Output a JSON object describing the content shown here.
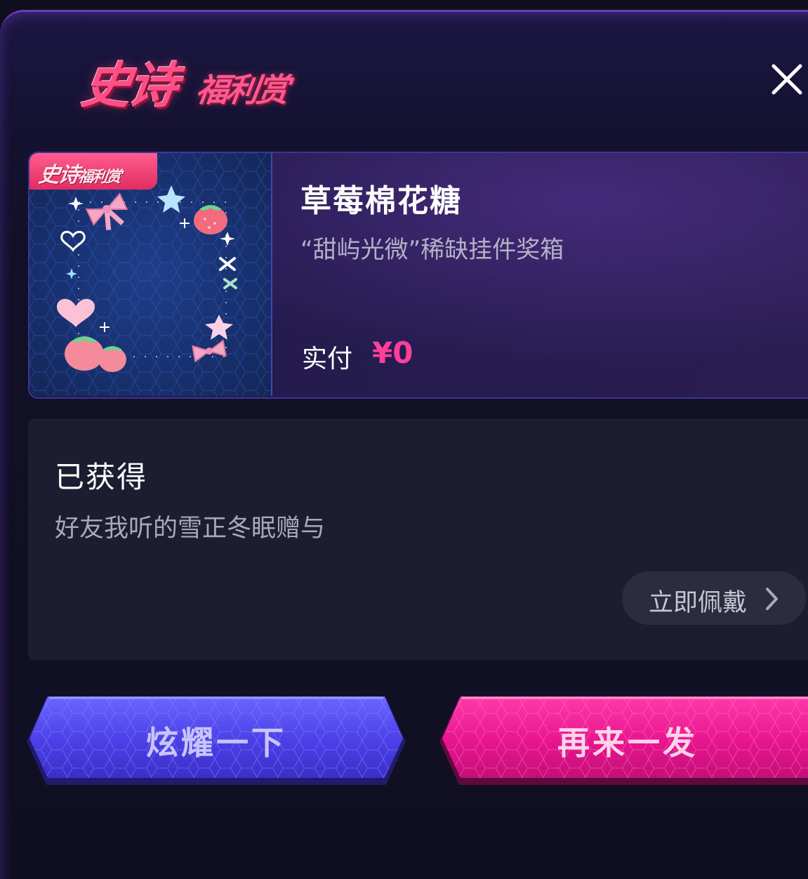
{
  "header": {
    "logo_main": "史诗",
    "logo_sub": "福利赏",
    "close_icon": "close-icon"
  },
  "prize": {
    "badge_main": "史诗",
    "badge_sub": "福利赏",
    "name": "草莓棉花糖",
    "description": "“甜屿光微”稀缺挂件奖箱",
    "price_label": "实付",
    "price_value": "¥0"
  },
  "obtained": {
    "title": "已获得",
    "from": "好友我听的雪正冬眠赠与",
    "wear_button_label": "立即佩戴",
    "wear_icon": "chevron-right-icon"
  },
  "actions": {
    "show_off_label": "炫耀一下",
    "again_label": "再来一发"
  },
  "colors": {
    "background": "#0f0e1d",
    "accent_pink": "#ff3f9c",
    "logo_pink": "#ff4f86",
    "button_blue": "#4a44e0",
    "button_pink": "#e61a8d"
  }
}
